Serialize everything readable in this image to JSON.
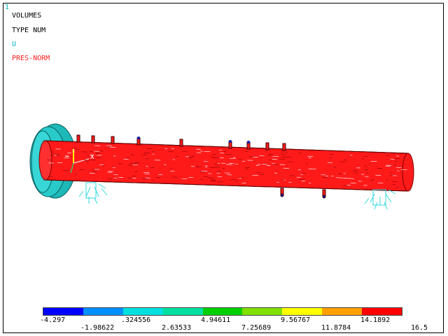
{
  "window_number": "1",
  "header": {
    "line1": "VOLUMES",
    "line2": "TYPE NUM",
    "line3": "U",
    "line4": "PRES-NORM"
  },
  "colors": {
    "line1": "#000000",
    "line2": "#000000",
    "line3": "#00b0c0",
    "line4": "#ff2020",
    "window_number": "#00b0c0",
    "pipe": "#ff1a1a",
    "flange": "#20c0c0",
    "constraint": "#30d8e0",
    "axis_x": "#ffffff",
    "axis_y": "#ffff00"
  },
  "triad": {
    "x_label": "X"
  },
  "legend": {
    "swatches": [
      "#0000ff",
      "#0090ff",
      "#00e0e0",
      "#00e0a0",
      "#00d000",
      "#80e000",
      "#ffff00",
      "#ffa000",
      "#ff0000"
    ],
    "top_labels": [
      "-4.297",
      ".324556",
      "4.94611",
      "9.56767",
      "14.1892"
    ],
    "bottom_labels": [
      "-1.98622",
      "2.63533",
      "7.25689",
      "11.8784",
      "16.5"
    ]
  }
}
